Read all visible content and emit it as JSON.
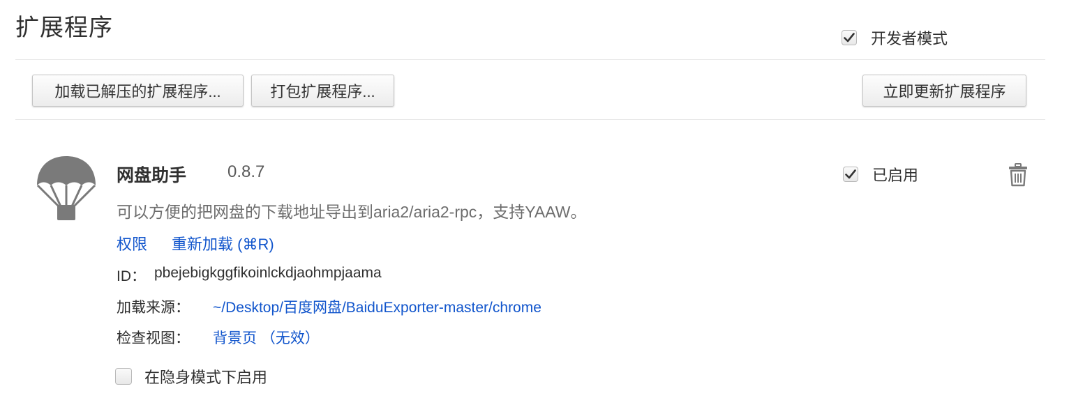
{
  "header": {
    "title": "扩展程序",
    "developer_mode": {
      "label": "开发者模式",
      "checked": true
    }
  },
  "toolbar": {
    "load_unpacked_label": "加载已解压的扩展程序...",
    "pack_label": "打包扩展程序...",
    "update_now_label": "立即更新扩展程序"
  },
  "extension": {
    "icon": "parachute-icon",
    "name": "网盘助手",
    "version": "0.8.7",
    "description": "可以方便的把网盘的下载地址导出到aria2/aria2-rpc，支持YAAW。",
    "links": {
      "permissions": "权限",
      "reload": "重新加载 (⌘R)"
    },
    "id_label": "ID：",
    "id_value": "pbejebigkggfikoinlckdjaohmpjaama",
    "source_label": "加载来源：",
    "source_value": "~/Desktop/百度网盘/BaiduExporter-master/chrome",
    "inspect_label": "检查视图：",
    "inspect_value": "背景页 （无效）",
    "enabled_label": "已启用",
    "enabled_checked": true,
    "remove_icon": "trash-icon",
    "incognito_label": "在隐身模式下启用",
    "incognito_checked": false
  },
  "colors": {
    "link": "#1155cc",
    "text": "#303030",
    "muted": "#6d6d6d",
    "icon_gray": "#7a7a7a"
  }
}
